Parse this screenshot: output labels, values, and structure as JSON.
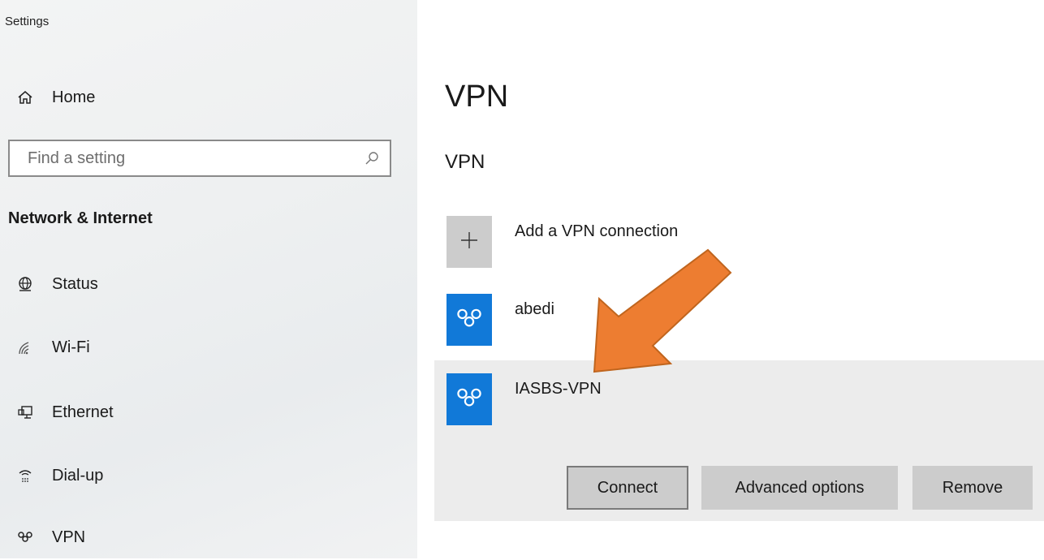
{
  "window": {
    "title": "Settings"
  },
  "sidebar": {
    "home_label": "Home",
    "search": {
      "placeholder": "Find a setting",
      "value": ""
    },
    "section_title": "Network & Internet",
    "items": [
      {
        "label": "Status",
        "icon": "globe-icon"
      },
      {
        "label": "Wi-Fi",
        "icon": "wifi-icon"
      },
      {
        "label": "Ethernet",
        "icon": "ethernet-icon"
      },
      {
        "label": "Dial-up",
        "icon": "dial-up-icon"
      },
      {
        "label": "VPN",
        "icon": "vpn-icon"
      }
    ]
  },
  "main": {
    "page_title": "VPN",
    "section_title": "VPN",
    "add_connection_label": "Add a VPN connection",
    "connections": [
      {
        "name": "abedi",
        "icon": "vpn-icon"
      },
      {
        "name": "IASBS-VPN",
        "icon": "vpn-icon",
        "selected": true
      }
    ],
    "actions": {
      "connect": "Connect",
      "advanced": "Advanced options",
      "remove": "Remove"
    }
  },
  "colors": {
    "accent": "#1179d8",
    "annotation_arrow": "#ed7d31",
    "selected_bg": "#ececec",
    "button_bg": "#cccccc"
  }
}
